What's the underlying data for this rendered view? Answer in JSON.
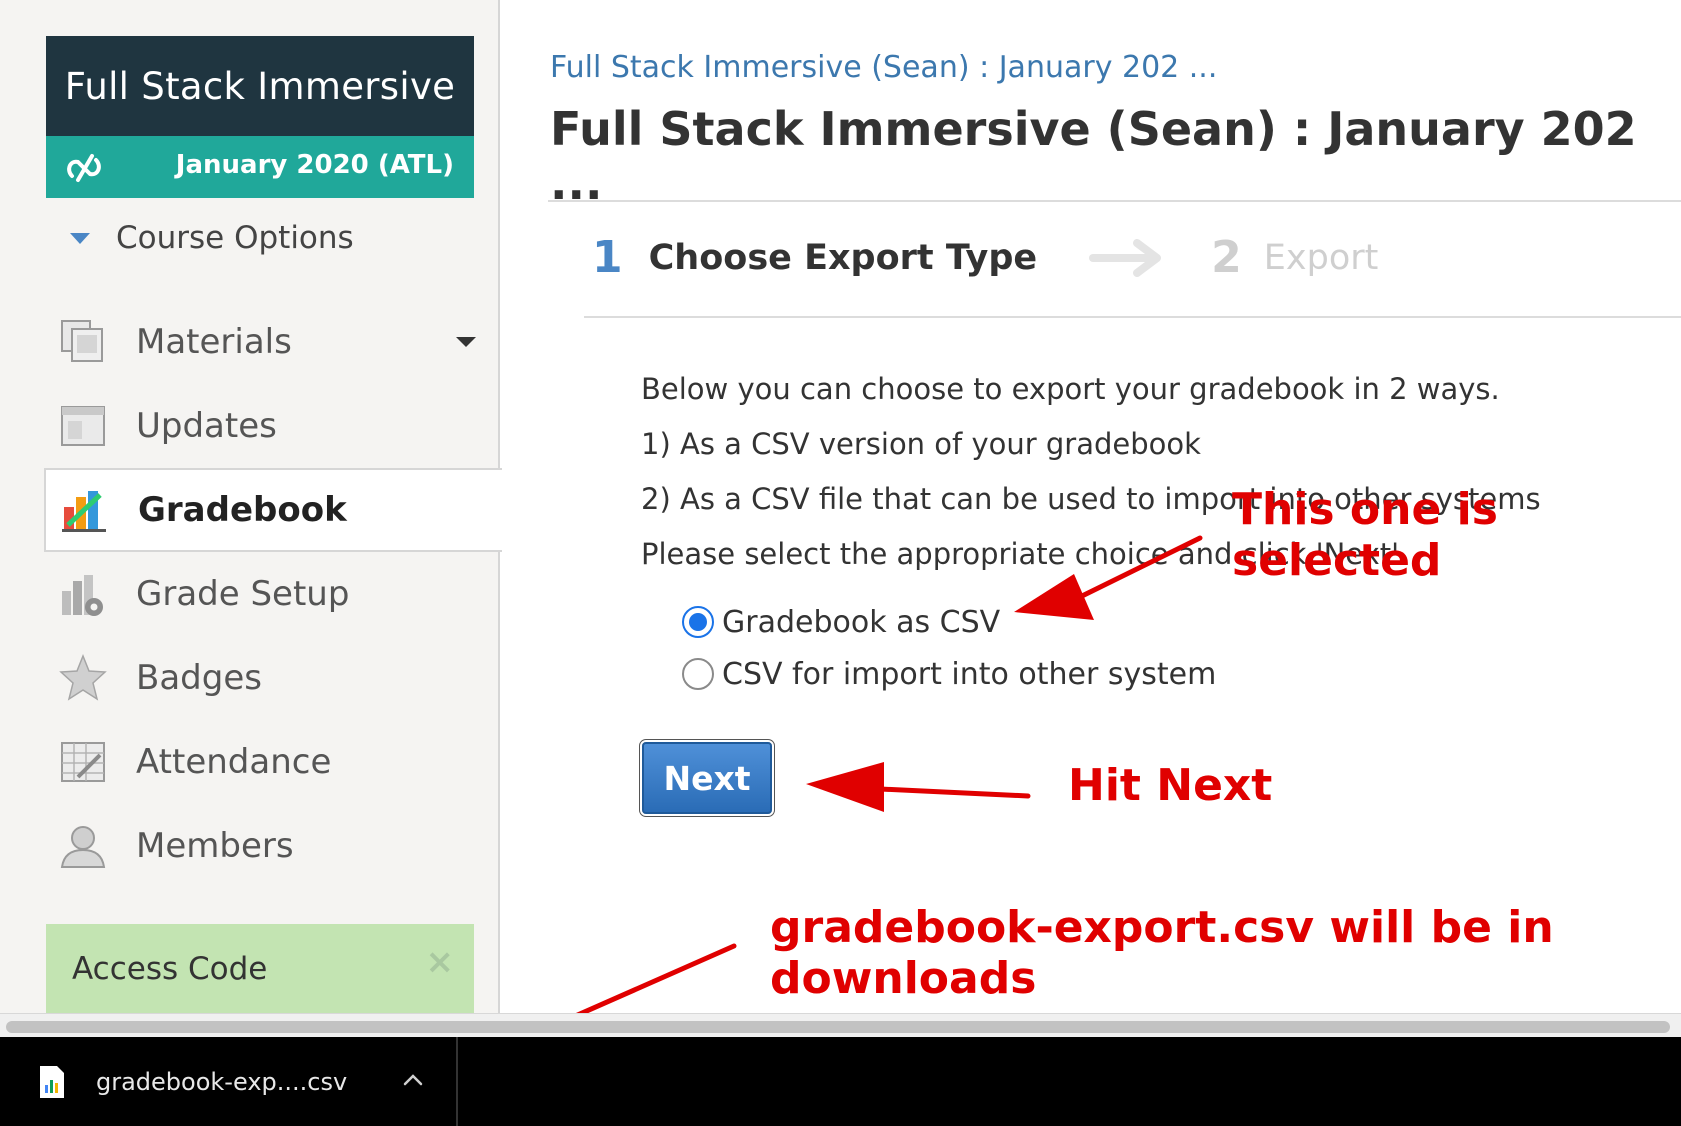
{
  "sidebar": {
    "course_card": {
      "title": "Full Stack Immersive",
      "term": "January 2020 (ATL)"
    },
    "course_options_label": "Course Options",
    "items": [
      {
        "label": "Materials"
      },
      {
        "label": "Updates"
      },
      {
        "label": "Gradebook"
      },
      {
        "label": "Grade Setup"
      },
      {
        "label": "Badges"
      },
      {
        "label": "Attendance"
      },
      {
        "label": "Members"
      }
    ],
    "access_code": {
      "label": "Access Code",
      "close": "×"
    }
  },
  "main": {
    "breadcrumb": "Full Stack Immersive (Sean) : January 202 ...",
    "title": "Full Stack Immersive (Sean) : January 202 ...",
    "steps": [
      {
        "number": "1",
        "label": "Choose Export Type"
      },
      {
        "number": "2",
        "label": "Export"
      }
    ],
    "description": [
      "Below you can choose to export your gradebook in 2 ways.",
      "1) As a CSV version of your gradebook",
      "2) As a CSV file that can be used to import into other systems",
      "Please select the appropriate choice and click 'Next'"
    ],
    "options": [
      {
        "label": "Gradebook as CSV",
        "checked": true
      },
      {
        "label": "CSV for import into other system",
        "checked": false
      }
    ],
    "next_label": "Next"
  },
  "annotations": {
    "selected": "This one is selected",
    "hit_next": "Hit Next",
    "downloads": "gradebook-export.csv will be in downloads"
  },
  "download_bar": {
    "file_name": "gradebook-exp....csv"
  },
  "colors": {
    "accent_red": "#e00000",
    "link_blue": "#3c78ae",
    "card_dark": "#1f3540",
    "card_teal": "#20a89a"
  }
}
